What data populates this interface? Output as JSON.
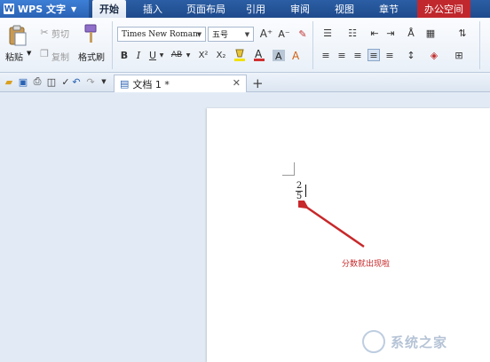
{
  "app": {
    "name": "WPS 文字",
    "logo": "W"
  },
  "tabs": [
    {
      "label": "开始"
    },
    {
      "label": "插入"
    },
    {
      "label": "页面布局"
    },
    {
      "label": "引用"
    },
    {
      "label": "审阅"
    },
    {
      "label": "视图"
    },
    {
      "label": "章节"
    },
    {
      "label": "办公空间"
    }
  ],
  "ribbon": {
    "paste_label": "粘贴",
    "cut_label": "剪切",
    "copy_label": "复制",
    "format_painter_label": "格式刷",
    "font_name": "Times New Roman",
    "font_size": "五号",
    "bold": "B",
    "italic": "I",
    "underline": "U",
    "ab": "AB",
    "superscript": "X²",
    "subscript": "X₂",
    "grow": "A⁺",
    "shrink": "A⁻"
  },
  "document": {
    "tab_label": "文档 1 *"
  },
  "content": {
    "numerator": "2",
    "denominator": "5",
    "annotation": "分数就出现啦"
  },
  "watermark": {
    "text": "系统之家"
  },
  "colors": {
    "menubar": "#1f4b8c",
    "accent_red": "#c8282a",
    "office_tab": "#c0282d"
  }
}
